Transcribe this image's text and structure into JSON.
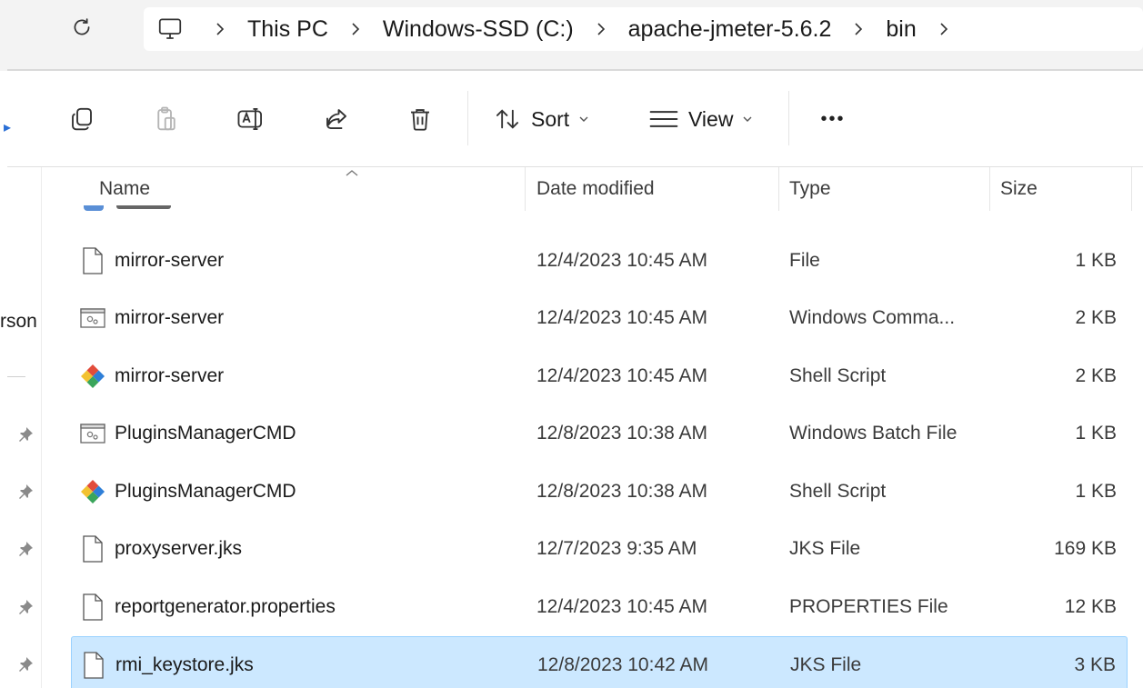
{
  "breadcrumb": {
    "items": [
      "This PC",
      "Windows-SSD (C:)",
      "apache-jmeter-5.6.2",
      "bin"
    ]
  },
  "toolbar": {
    "sort_label": "Sort",
    "view_label": "View",
    "more_label": "•••"
  },
  "navigation": {
    "partial_text": "rson"
  },
  "columns": {
    "name": "Name",
    "date": "Date modified",
    "type": "Type",
    "size": "Size"
  },
  "files": [
    {
      "name": "mirror-server",
      "date": "12/4/2023 10:45 AM",
      "type": "File",
      "size": "1 KB",
      "icon": "blank-file-icon"
    },
    {
      "name": "mirror-server",
      "date": "12/4/2023 10:45 AM",
      "type": "Windows Comma...",
      "size": "2 KB",
      "icon": "batch-file-icon"
    },
    {
      "name": "mirror-server",
      "date": "12/4/2023 10:45 AM",
      "type": "Shell Script",
      "size": "2 KB",
      "icon": "git-shell-icon"
    },
    {
      "name": "PluginsManagerCMD",
      "date": "12/8/2023 10:38 AM",
      "type": "Windows Batch File",
      "size": "1 KB",
      "icon": "batch-file-icon"
    },
    {
      "name": "PluginsManagerCMD",
      "date": "12/8/2023 10:38 AM",
      "type": "Shell Script",
      "size": "1 KB",
      "icon": "git-shell-icon"
    },
    {
      "name": "proxyserver.jks",
      "date": "12/7/2023 9:35 AM",
      "type": "JKS File",
      "size": "169 KB",
      "icon": "blank-file-icon"
    },
    {
      "name": "reportgenerator.properties",
      "date": "12/4/2023 10:45 AM",
      "type": "PROPERTIES File",
      "size": "12 KB",
      "icon": "blank-file-icon"
    },
    {
      "name": "rmi_keystore.jks",
      "date": "12/8/2023 10:42 AM",
      "type": "JKS File",
      "size": "3 KB",
      "icon": "blank-file-icon",
      "selected": true
    }
  ],
  "colors": {
    "selection": "#cce8ff",
    "selection_border": "#99d1ff",
    "accent": "#2a6fd6"
  }
}
